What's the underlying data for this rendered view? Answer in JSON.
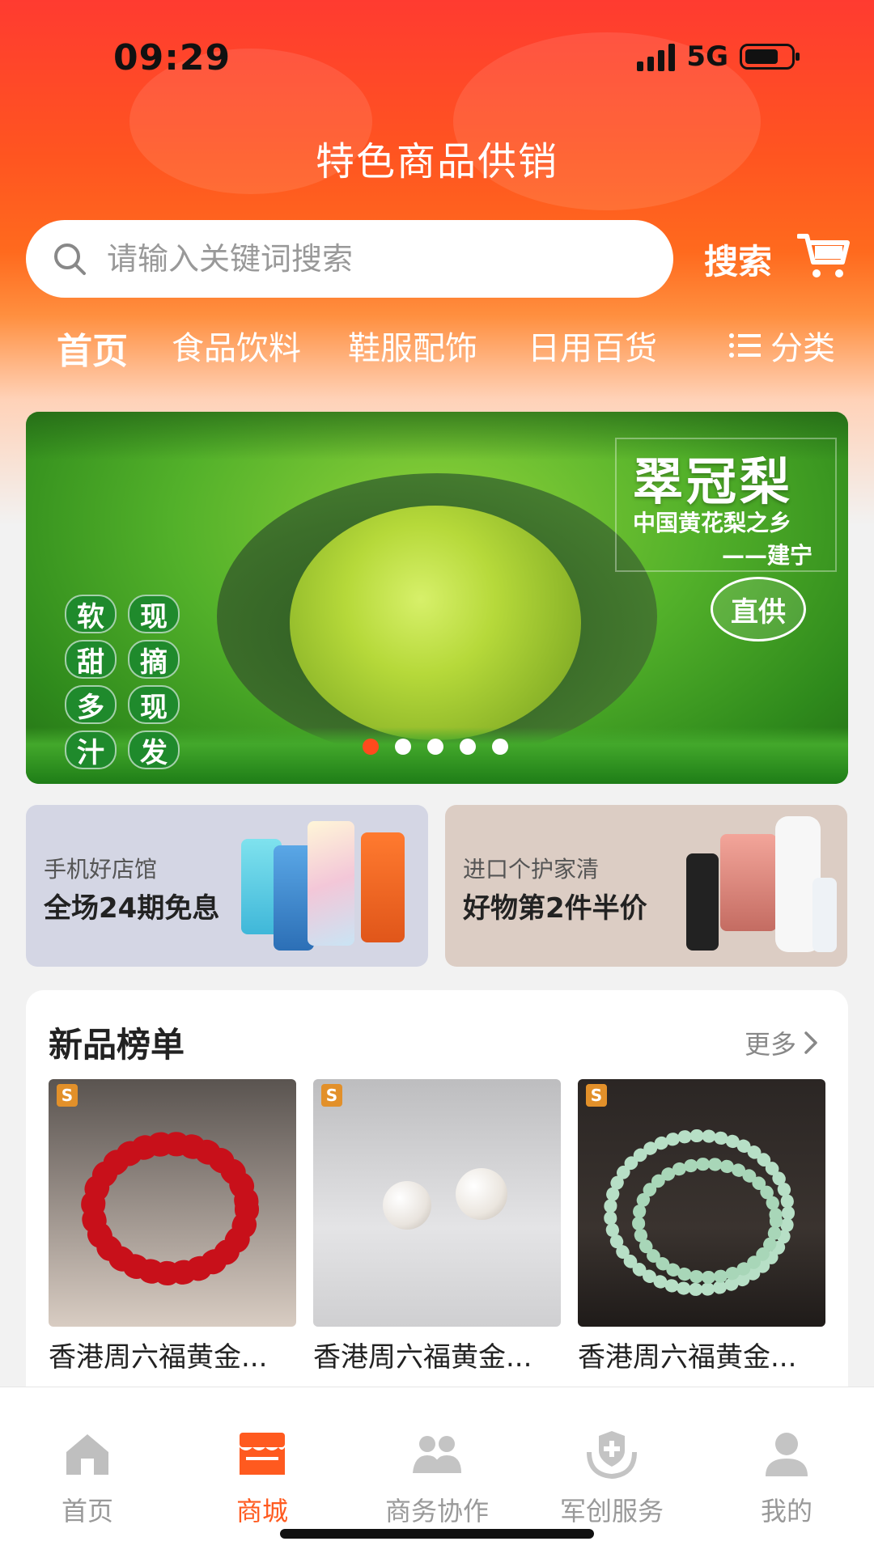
{
  "status_bar": {
    "time": "09:29",
    "network": "5G"
  },
  "header": {
    "title": "特色商品供销"
  },
  "search": {
    "placeholder": "请输入关键词搜索",
    "button_label": "搜索"
  },
  "categories": {
    "items": [
      "首页",
      "食品饮料",
      "鞋服配饰",
      "日用百货"
    ],
    "active_index": 0,
    "menu_label": "分类"
  },
  "banner": {
    "title": "翠冠梨",
    "subtitle_line1": "中国黄花梨之乡",
    "subtitle_line2": "——建宁",
    "badge": "直供",
    "slogan_left": [
      "软",
      "甜",
      "多",
      "汁"
    ],
    "slogan_right": [
      "现",
      "摘",
      "现",
      "发"
    ],
    "dots_count": 5,
    "active_dot": 0
  },
  "promos": [
    {
      "subtitle": "手机好店馆",
      "headline": "全场24期免息"
    },
    {
      "subtitle": "进口个护家清",
      "headline": "好物第2件半价"
    }
  ],
  "new_products": {
    "title": "新品榜单",
    "more_label": "更多",
    "items": [
      {
        "name": "香港周六福黄金...",
        "image": "red-agate-bracelet"
      },
      {
        "name": "香港周六福黄金...",
        "image": "pearl-earrings"
      },
      {
        "name": "香港周六福黄金...",
        "image": "jade-bead-necklace"
      }
    ]
  },
  "tabbar": {
    "items": [
      {
        "label": "首页",
        "icon": "home-icon"
      },
      {
        "label": "商城",
        "icon": "store-icon"
      },
      {
        "label": "商务协作",
        "icon": "business-icon"
      },
      {
        "label": "军创服务",
        "icon": "service-icon"
      },
      {
        "label": "我的",
        "icon": "profile-icon"
      }
    ],
    "active_index": 1
  },
  "colors": {
    "accent": "#ff5a1f",
    "header_red": "#ff3b30",
    "banner_green": "#3c9a24"
  }
}
